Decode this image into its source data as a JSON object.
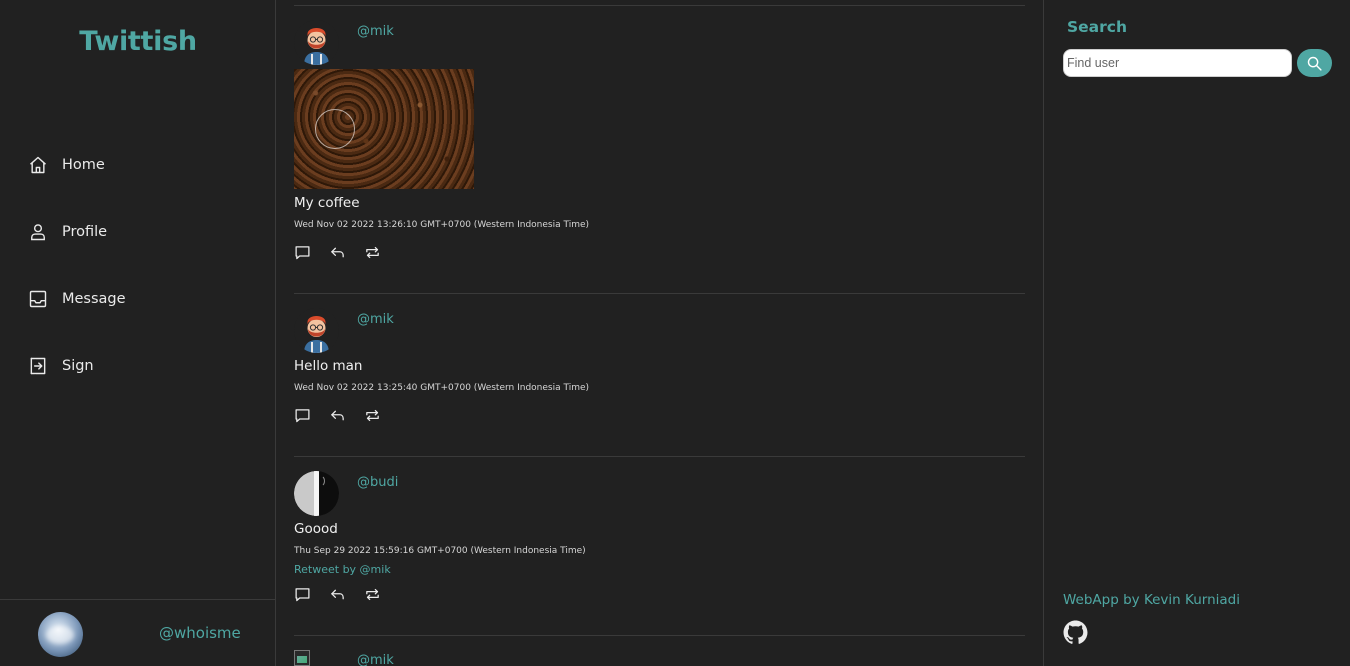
{
  "app": {
    "title": "Twittish"
  },
  "sidebar": {
    "items": [
      {
        "label": "Home",
        "icon": "home-icon"
      },
      {
        "label": "Profile",
        "icon": "user-icon"
      },
      {
        "label": "Message",
        "icon": "inbox-icon"
      },
      {
        "label": "Sign",
        "icon": "sign-in-icon"
      }
    ],
    "me": {
      "handle": "@whoisme"
    }
  },
  "feed": {
    "posts": [
      {
        "handle": "@mik",
        "avatar": "bearded-man-avatar",
        "has_image": true,
        "text": "My coffee",
        "time": "Wed Nov 02 2022 13:26:10 GMT+0700 (Western Indonesia Time)"
      },
      {
        "handle": "@mik",
        "avatar": "bearded-man-avatar",
        "has_image": false,
        "text": "Hello man",
        "time": "Wed Nov 02 2022 13:25:40 GMT+0700 (Western Indonesia Time)"
      },
      {
        "handle": "@budi",
        "avatar": "half-moon-avatar",
        "has_image": false,
        "text": "Goood",
        "time": "Thu Sep 29 2022 15:59:16 GMT+0700 (Western Indonesia Time)",
        "retweet": "Retweet by @mik"
      },
      {
        "handle": "@mik",
        "avatar": "broken-image-avatar"
      }
    ]
  },
  "search": {
    "title": "Search",
    "placeholder": "Find user",
    "value": ""
  },
  "footer": {
    "credit": "WebApp by Kevin Kurniadi",
    "icon": "github-icon"
  },
  "colors": {
    "accent": "#4fa7a3",
    "background": "#212121",
    "divider": "#3a3a3a"
  }
}
